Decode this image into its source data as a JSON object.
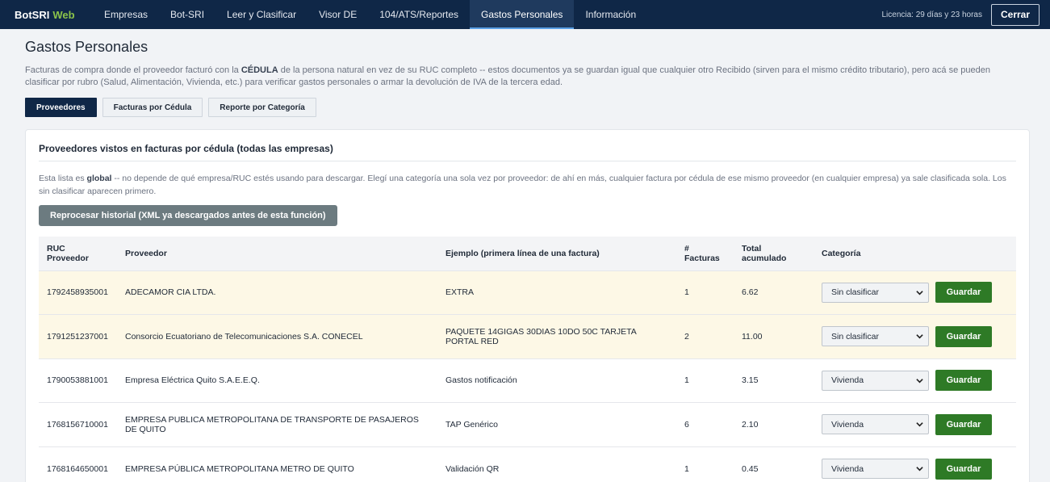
{
  "brand": {
    "name": "BotSRI",
    "suffix": "Web"
  },
  "nav": [
    {
      "label": "Empresas"
    },
    {
      "label": "Bot-SRI"
    },
    {
      "label": "Leer y Clasificar"
    },
    {
      "label": "Visor DE"
    },
    {
      "label": "104/ATS/Reportes"
    },
    {
      "label": "Gastos Personales",
      "active": true
    },
    {
      "label": "Información"
    }
  ],
  "license": "Licencia: 29 días y 23 horas",
  "logout_label": "Cerrar",
  "page": {
    "title": "Gastos Personales",
    "desc_pre": "Facturas de compra donde el proveedor facturó con la ",
    "desc_bold": "CÉDULA",
    "desc_post": " de la persona natural en vez de su RUC completo -- estos documentos ya se guardan igual que cualquier otro Recibido (sirven para el mismo crédito tributario), pero acá se pueden clasificar por rubro (Salud, Alimentación, Vivienda, etc.) para verificar gastos personales o armar la devolución de IVA de la tercera edad."
  },
  "tabs": [
    {
      "label": "Proveedores",
      "active": true
    },
    {
      "label": "Facturas por Cédula"
    },
    {
      "label": "Reporte por Categoría"
    }
  ],
  "card": {
    "title": "Proveedores vistos en facturas por cédula (todas las empresas)",
    "desc_pre": "Esta lista es ",
    "desc_bold": "global",
    "desc_post": " -- no depende de qué empresa/RUC estés usando para descargar. Elegí una categoría una sola vez por proveedor: de ahí en más, cualquier factura por cédula de ese mismo proveedor (en cualquier empresa) ya sale clasificada sola. Los sin clasificar aparecen primero.",
    "reprocess_label": "Reprocesar historial (XML ya descargados antes de esta función)"
  },
  "table": {
    "headers": {
      "ruc_1": "RUC",
      "ruc_2": "Proveedor",
      "proveedor": "Proveedor",
      "ejemplo": "Ejemplo (primera línea de una factura)",
      "num_1": "#",
      "num_2": "Facturas",
      "total_1": "Total",
      "total_2": "acumulado",
      "categoria": "Categoría"
    },
    "save_label": "Guardar",
    "rows": [
      {
        "ruc": "1792458935001",
        "proveedor": "ADECAMOR CIA LTDA.",
        "ejemplo": "EXTRA",
        "facturas": "1",
        "total": "6.62",
        "categoria": "Sin clasificar"
      },
      {
        "ruc": "1791251237001",
        "proveedor": "Consorcio Ecuatoriano de Telecomunicaciones S.A. CONECEL",
        "ejemplo": "PAQUETE 14GIGAS 30DIAS 10DO 50C TARJETA PORTAL RED",
        "facturas": "2",
        "total": "11.00",
        "categoria": "Sin clasificar"
      },
      {
        "ruc": "1790053881001",
        "proveedor": "Empresa Eléctrica Quito S.A.E.E.Q.",
        "ejemplo": "Gastos notificación",
        "facturas": "1",
        "total": "3.15",
        "categoria": "Vivienda"
      },
      {
        "ruc": "1768156710001",
        "proveedor": "EMPRESA PUBLICA METROPOLITANA DE TRANSPORTE DE PASAJEROS DE QUITO",
        "ejemplo": "TAP Genérico",
        "facturas": "6",
        "total": "2.10",
        "categoria": "Vivienda"
      },
      {
        "ruc": "1768164650001",
        "proveedor": "EMPRESA PÚBLICA METROPOLITANA METRO DE QUITO",
        "ejemplo": "Validación QR",
        "facturas": "1",
        "total": "0.45",
        "categoria": "Vivienda"
      }
    ]
  }
}
